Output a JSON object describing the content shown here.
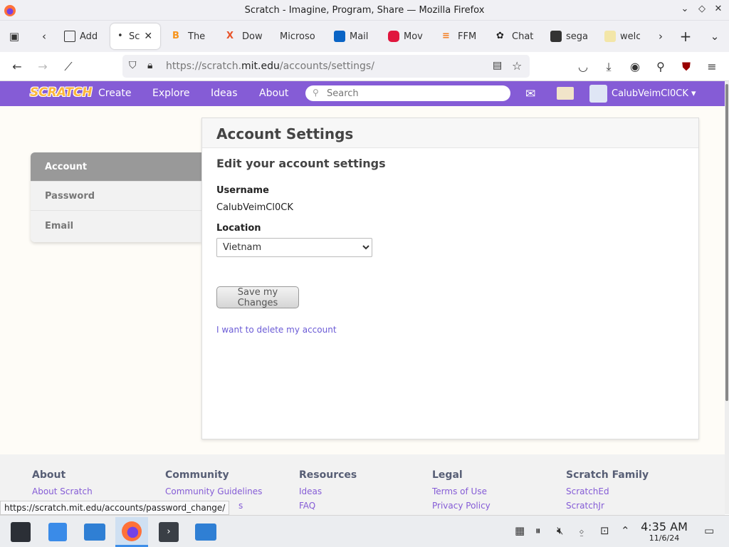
{
  "window": {
    "title": "Scratch - Imagine, Program, Share — Mozilla Firefox",
    "controls": [
      "chevron-down",
      "diamond",
      "close"
    ]
  },
  "tabs": [
    {
      "label": "Add",
      "icon": "puzzle-icon",
      "color": "#333333"
    },
    {
      "label": "Sc",
      "icon": "scratch-icon",
      "color": "#855cd6",
      "active": true
    },
    {
      "label": "The",
      "icon": "bitcoin-icon",
      "color": "#f7931a"
    },
    {
      "label": "Dow",
      "icon": "x-icon",
      "color": "#e8542a"
    },
    {
      "label": "Microso",
      "icon": "microsoft-icon",
      "color": "#ffffff"
    },
    {
      "label": "Mail",
      "icon": "outlook-icon",
      "color": "#0a64c5"
    },
    {
      "label": "Mov",
      "icon": "youtube-icon",
      "color": "#e0163d"
    },
    {
      "label": "FFM",
      "icon": "stackoverflow-icon",
      "color": "#f48024"
    },
    {
      "label": "Chat",
      "icon": "openai-icon",
      "color": "#222222"
    },
    {
      "label": "sega",
      "icon": "sega-icon",
      "color": "#333333"
    },
    {
      "label": "welc",
      "icon": "welcome-icon",
      "color": "#e8c84a"
    }
  ],
  "nav": {
    "url_prefix": "https://scratch.",
    "url_domain": "mit.edu",
    "url_path": "/accounts/settings/"
  },
  "scratch": {
    "logo": "SCRATCH",
    "links": [
      "Create",
      "Explore",
      "Ideas",
      "About"
    ],
    "search_placeholder": "Search",
    "username": "CalubVeimCl0CK"
  },
  "sidebar": {
    "items": [
      {
        "label": "Account",
        "active": true
      },
      {
        "label": "Password"
      },
      {
        "label": "Email"
      }
    ]
  },
  "main": {
    "title": "Account Settings",
    "subtitle": "Edit your account settings",
    "username_label": "Username",
    "username_value": "CalubVeimCl0CK",
    "location_label": "Location",
    "location_value": "Vietnam",
    "save_label": "Save my Changes",
    "delete_label": "I want to delete my account"
  },
  "footer": {
    "columns": [
      {
        "heading": "About",
        "links": [
          "About Scratch"
        ]
      },
      {
        "heading": "Community",
        "links": [
          "Community Guidelines"
        ]
      },
      {
        "heading": "Resources",
        "links": [
          "Ideas",
          "FAQ"
        ]
      },
      {
        "heading": "Legal",
        "links": [
          "Terms of Use",
          "Privacy Policy"
        ]
      },
      {
        "heading": "Scratch Family",
        "links": [
          "ScratchEd",
          "ScratchJr"
        ]
      }
    ],
    "partial_text": "s"
  },
  "status_tooltip": "https://scratch.mit.edu/accounts/password_change/",
  "taskbar": {
    "time": "4:35 AM",
    "date": "11/6/24"
  }
}
